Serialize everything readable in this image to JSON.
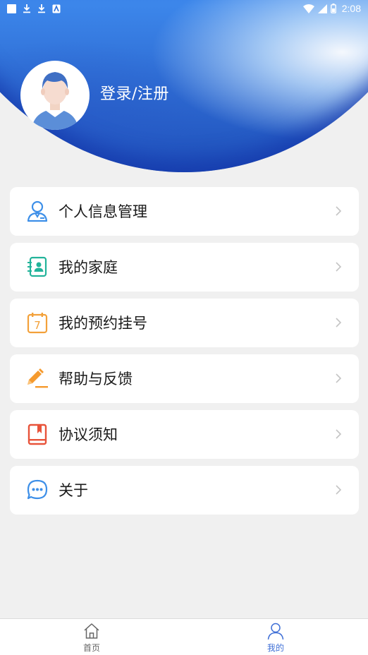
{
  "status_bar": {
    "time": "2:08"
  },
  "profile": {
    "login_label": "登录/注册"
  },
  "menu": {
    "items": [
      {
        "label": "个人信息管理",
        "icon": "person-icon",
        "color": "#3d8fe8"
      },
      {
        "label": "我的家庭",
        "icon": "contact-card-icon",
        "color": "#22b39a"
      },
      {
        "label": "我的预约挂号",
        "icon": "calendar-icon",
        "color": "#f3a13a",
        "icon_text": "7"
      },
      {
        "label": "帮助与反馈",
        "icon": "pencil-icon",
        "color": "#f59a2e"
      },
      {
        "label": "协议须知",
        "icon": "book-icon",
        "color": "#e8533a"
      },
      {
        "label": "关于",
        "icon": "chat-bubble-icon",
        "color": "#3d8fe8"
      }
    ]
  },
  "bottom_nav": {
    "items": [
      {
        "label": "首页",
        "icon": "home-icon",
        "active": false
      },
      {
        "label": "我的",
        "icon": "profile-icon",
        "active": true
      }
    ],
    "active_color": "#3f6fd6",
    "inactive_color": "#666666"
  }
}
